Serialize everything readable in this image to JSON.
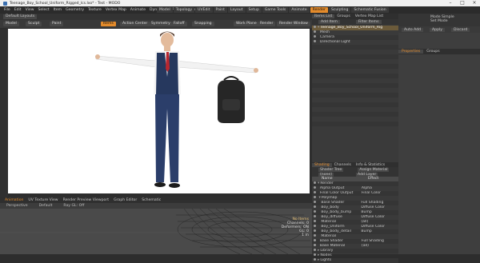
{
  "window": {
    "title": "Teenage_Boy_School_Uniform_Rigged_lcs.lxo* - Test - MODO"
  },
  "menu": [
    "File",
    "Edit",
    "View",
    "Select",
    "Item",
    "Geometry",
    "Texture",
    "Vertex Map",
    "Animate",
    "Dynamics",
    "Render",
    "MeshFusion",
    "Layout",
    "System",
    "Help"
  ],
  "layout_tabs": [
    "Model",
    "Topology",
    "UVEdit",
    "Paint",
    "Layout",
    "Setup",
    "Game Tools",
    "Animate",
    "Render",
    "Sculpting",
    "Schematic Fusion"
  ],
  "active_tab": "Render",
  "toolbar1": {
    "layout_label": "Default Layouts",
    "right_label": "Only"
  },
  "toolbar2": {
    "items": [
      "Model",
      "Sculpt",
      "Paint",
      "Items",
      "Action Center",
      "Symmetry",
      "Falloff",
      "Snapping",
      "Work Plane",
      "Render",
      "Render Window"
    ],
    "active": "Items"
  },
  "viewport": {
    "mode": "Perspective",
    "shade": "Default",
    "ray": "Ray GL: Off"
  },
  "bottom_tabs": [
    "Animation",
    "UV Texture View",
    "Render Preview Viewport",
    "Graph Editor",
    "Schematic"
  ],
  "bottom_view": {
    "mode": "Perspective",
    "shade": "Default",
    "ray": "Ray GL: Off",
    "stats": [
      "No Items",
      "Channels: 0",
      "Deformers: ON",
      "GL: 0",
      "1 m"
    ]
  },
  "items_panel": {
    "tabs": [
      "Items List",
      "Groups",
      "Vertex Map List"
    ],
    "add_item": "Add Item",
    "filter": "Filter Items",
    "items": [
      "Teenage_Boy_School_Uniform_Rig",
      "Mesh",
      "Camera",
      "Directional Light"
    ]
  },
  "shading_panel": {
    "tabs": [
      "Shading",
      "Channels",
      "Info & Statistics"
    ],
    "shader_tree": "Shader Tree",
    "assign_material": "Assign Material",
    "scene_label": "(none)",
    "add_layer": "Add Layer",
    "col_name": "Name",
    "col_effect": "Effect",
    "rows": [
      {
        "name": "Render",
        "effect": ""
      },
      {
        "name": "Alpha Output",
        "effect": "Alpha"
      },
      {
        "name": "Final Color Output",
        "effect": "Final Color"
      },
      {
        "name": "Polymap",
        "effect": ""
      },
      {
        "name": "Base Shader",
        "effect": "Full Shading"
      },
      {
        "name": "Boy_body",
        "effect": "Diffuse Color"
      },
      {
        "name": "Boy_body_bump",
        "effect": "Bump"
      },
      {
        "name": "Boy_diffuse",
        "effect": "Diffuse Color"
      },
      {
        "name": "Material",
        "effect": "(all)"
      },
      {
        "name": "Boy_Uniform",
        "effect": "Diffuse Color"
      },
      {
        "name": "Boy_body_detail",
        "effect": "Bump"
      },
      {
        "name": "Material",
        "effect": ""
      },
      {
        "name": "Base Shader",
        "effect": "Full Shading"
      },
      {
        "name": "Base Material",
        "effect": "(all)"
      },
      {
        "name": "Library",
        "effect": ""
      },
      {
        "name": "Nodes",
        "effect": ""
      },
      {
        "name": "Lights",
        "effect": ""
      }
    ]
  },
  "props_panel": {
    "top_label": "Mode Simple",
    "set_mode": "Set Mode",
    "auto_add": "Auto Add",
    "apply": "Apply",
    "discard": "Discard",
    "tabs": [
      "Properties",
      "Groups"
    ]
  },
  "colors": {
    "accent": "#e48b2b",
    "viewport_bg": "#ffffff",
    "panel": "#3a3a3a"
  }
}
